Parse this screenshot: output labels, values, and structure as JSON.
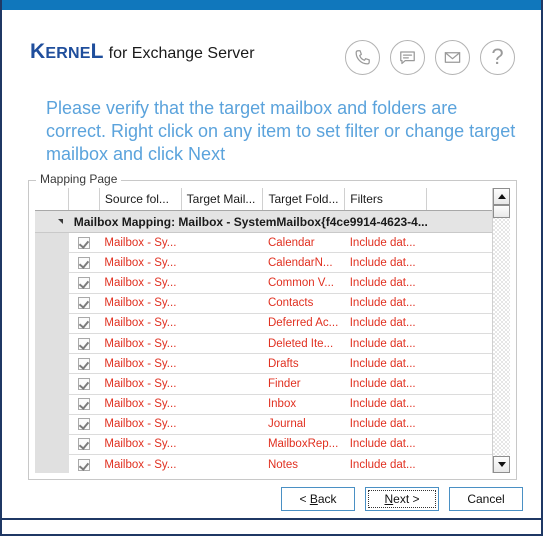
{
  "window": {
    "accent_titlebar": "#1077bc",
    "border_color": "#1f3864"
  },
  "header": {
    "brand_primary": "Kernel",
    "brand_secondary": "for Exchange Server",
    "icons": [
      {
        "name": "phone-icon",
        "label": "Phone support"
      },
      {
        "name": "chat-icon",
        "label": "Live chat"
      },
      {
        "name": "email-icon",
        "label": "Email support"
      },
      {
        "name": "help-icon",
        "label": "?"
      }
    ]
  },
  "instruction": {
    "text": "Please verify that the target mailbox and folders are correct. Right click on any item to set filter or change target mailbox and click Next",
    "color": "#5ba3dc"
  },
  "groupbox": {
    "label": "Mapping Page"
  },
  "grid": {
    "columns": [
      "",
      "",
      "Source fol...",
      "Target Mail...",
      "Target Fold...",
      "Filters",
      ""
    ],
    "group_row": {
      "expander": "expanded",
      "text": "Mailbox Mapping: Mailbox - SystemMailbox{f4ce9914-4623-4..."
    },
    "row_text_color": "#e03020",
    "rows": [
      {
        "checked": true,
        "source": "Mailbox - Sy...",
        "target_mailbox": "",
        "target_folder": "Calendar",
        "filters": "Include dat..."
      },
      {
        "checked": true,
        "source": "Mailbox - Sy...",
        "target_mailbox": "",
        "target_folder": "CalendarN...",
        "filters": "Include dat..."
      },
      {
        "checked": true,
        "source": "Mailbox - Sy...",
        "target_mailbox": "",
        "target_folder": "Common V...",
        "filters": "Include dat..."
      },
      {
        "checked": true,
        "source": "Mailbox - Sy...",
        "target_mailbox": "",
        "target_folder": "Contacts",
        "filters": "Include dat..."
      },
      {
        "checked": true,
        "source": "Mailbox - Sy...",
        "target_mailbox": "",
        "target_folder": "Deferred Ac...",
        "filters": "Include dat..."
      },
      {
        "checked": true,
        "source": "Mailbox - Sy...",
        "target_mailbox": "",
        "target_folder": "Deleted Ite...",
        "filters": "Include dat..."
      },
      {
        "checked": true,
        "source": "Mailbox - Sy...",
        "target_mailbox": "",
        "target_folder": "Drafts",
        "filters": "Include dat..."
      },
      {
        "checked": true,
        "source": "Mailbox - Sy...",
        "target_mailbox": "",
        "target_folder": "Finder",
        "filters": "Include dat..."
      },
      {
        "checked": true,
        "source": "Mailbox - Sy...",
        "target_mailbox": "",
        "target_folder": "Inbox",
        "filters": "Include dat..."
      },
      {
        "checked": true,
        "source": "Mailbox - Sy...",
        "target_mailbox": "",
        "target_folder": "Journal",
        "filters": "Include dat..."
      },
      {
        "checked": true,
        "source": "Mailbox - Sy...",
        "target_mailbox": "",
        "target_folder": "MailboxRep...",
        "filters": "Include dat..."
      },
      {
        "checked": true,
        "source": "Mailbox - Sy...",
        "target_mailbox": "",
        "target_folder": "Notes",
        "filters": "Include dat..."
      }
    ]
  },
  "scrollbar": {
    "orientation": "vertical",
    "up_arrow": "▲",
    "down_arrow": "▼",
    "thumb_position": "top"
  },
  "footer": {
    "buttons": [
      {
        "name": "back-button",
        "label": "< Back",
        "default": false
      },
      {
        "name": "next-button",
        "label": "Next >",
        "default": true
      },
      {
        "name": "cancel-button",
        "label": "Cancel",
        "default": false
      }
    ]
  }
}
